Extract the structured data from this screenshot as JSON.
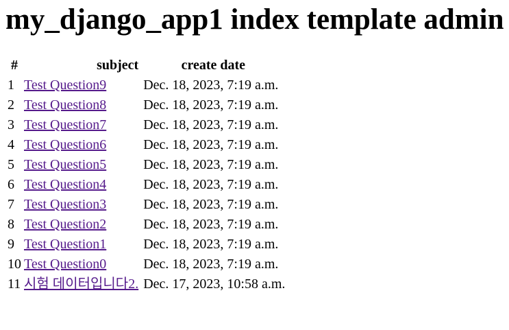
{
  "page": {
    "title": "my_django_app1 index template admin"
  },
  "table": {
    "headers": {
      "num": "#",
      "subject": "subject",
      "create_date": "create date"
    },
    "rows": [
      {
        "num": "1",
        "subject": "Test Question9",
        "create_date": "Dec. 18, 2023, 7:19 a.m."
      },
      {
        "num": "2",
        "subject": "Test Question8",
        "create_date": "Dec. 18, 2023, 7:19 a.m."
      },
      {
        "num": "3",
        "subject": "Test Question7",
        "create_date": "Dec. 18, 2023, 7:19 a.m."
      },
      {
        "num": "4",
        "subject": "Test Question6",
        "create_date": "Dec. 18, 2023, 7:19 a.m."
      },
      {
        "num": "5",
        "subject": "Test Question5",
        "create_date": "Dec. 18, 2023, 7:19 a.m."
      },
      {
        "num": "6",
        "subject": "Test Question4",
        "create_date": "Dec. 18, 2023, 7:19 a.m."
      },
      {
        "num": "7",
        "subject": "Test Question3",
        "create_date": "Dec. 18, 2023, 7:19 a.m."
      },
      {
        "num": "8",
        "subject": "Test Question2",
        "create_date": "Dec. 18, 2023, 7:19 a.m."
      },
      {
        "num": "9",
        "subject": "Test Question1",
        "create_date": "Dec. 18, 2023, 7:19 a.m."
      },
      {
        "num": "10",
        "subject": "Test Question0",
        "create_date": "Dec. 18, 2023, 7:19 a.m."
      },
      {
        "num": "11",
        "subject": "시험 데이터입니다2.",
        "create_date": "Dec. 17, 2023, 10:58 a.m."
      }
    ]
  },
  "colors": {
    "visited_link": "#551a8b",
    "text": "#000000",
    "background": "#ffffff"
  }
}
